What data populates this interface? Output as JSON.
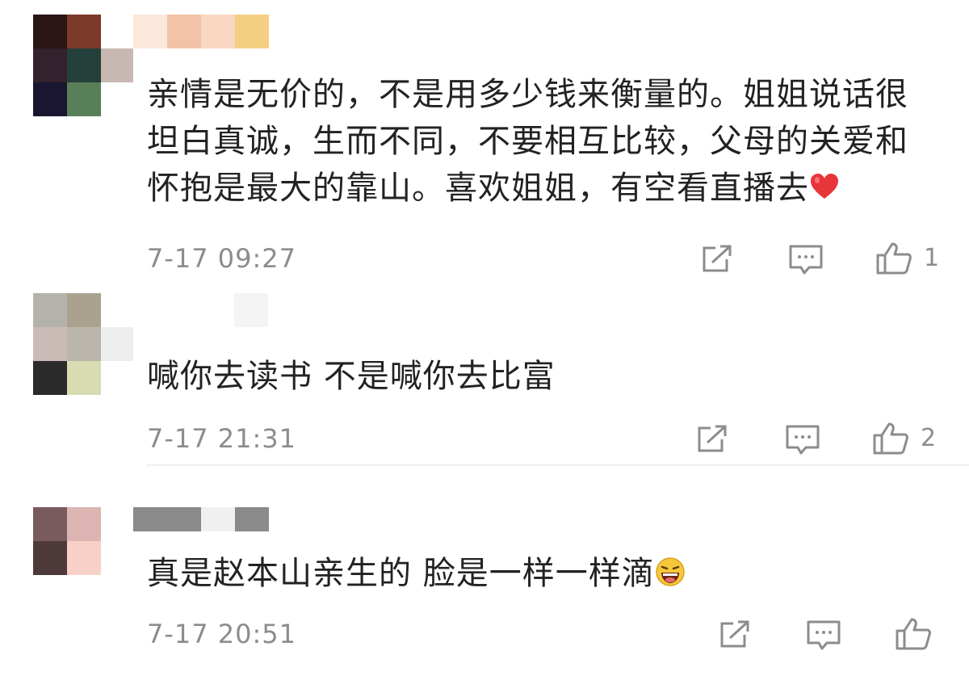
{
  "comments": [
    {
      "text": "亲情是无价的，不是用多少钱来衡量的。姐姐说话很坦白真诚，生而不同，不要相互比较，父母的关爱和怀抱是最大的靠山。喜欢姐姐，有空看直播去",
      "emoji": "red-heart",
      "date": "7-17 09:27",
      "likes": "1",
      "avatar_colors": [
        "#2b1516",
        "#7b3a2a",
        "#33222e",
        "#24403a",
        "#1a1530",
        "#587f58"
      ],
      "name_colors": [
        "#fbe8da",
        "#f2c3a6",
        "#f8d8c3",
        "#f4cf82"
      ]
    },
    {
      "text": "喊你去读书 不是喊你去比富",
      "date": "7-17 21:31",
      "likes": "2",
      "avatar_colors": [
        "#b5b1ab",
        "#aaa28f",
        "#cbbbb7",
        "#bab5ad",
        "#2b2b2b",
        "#d9dcb3"
      ],
      "name_colors": [
        "#f4f4f4"
      ]
    },
    {
      "text": "真是赵本山亲生的 脸是一样一样滴",
      "emoji": "laughing-face",
      "date": "7-17 20:51",
      "likes": "",
      "avatar_colors": [
        "#795a5d",
        "#dcb4b2",
        "#4e3a3a",
        "#f7d1c8"
      ],
      "name_colors": [
        "#8a8a8a",
        "#8a8a8a",
        "#f0f0f0",
        "#8a8a8a"
      ]
    }
  ],
  "icons": [
    "share-icon",
    "reply-icon",
    "like-icon"
  ],
  "colors": {
    "text": "#222222",
    "meta": "#8c8c8c",
    "divider": "#eeeeee",
    "heart": "#e8353a"
  }
}
